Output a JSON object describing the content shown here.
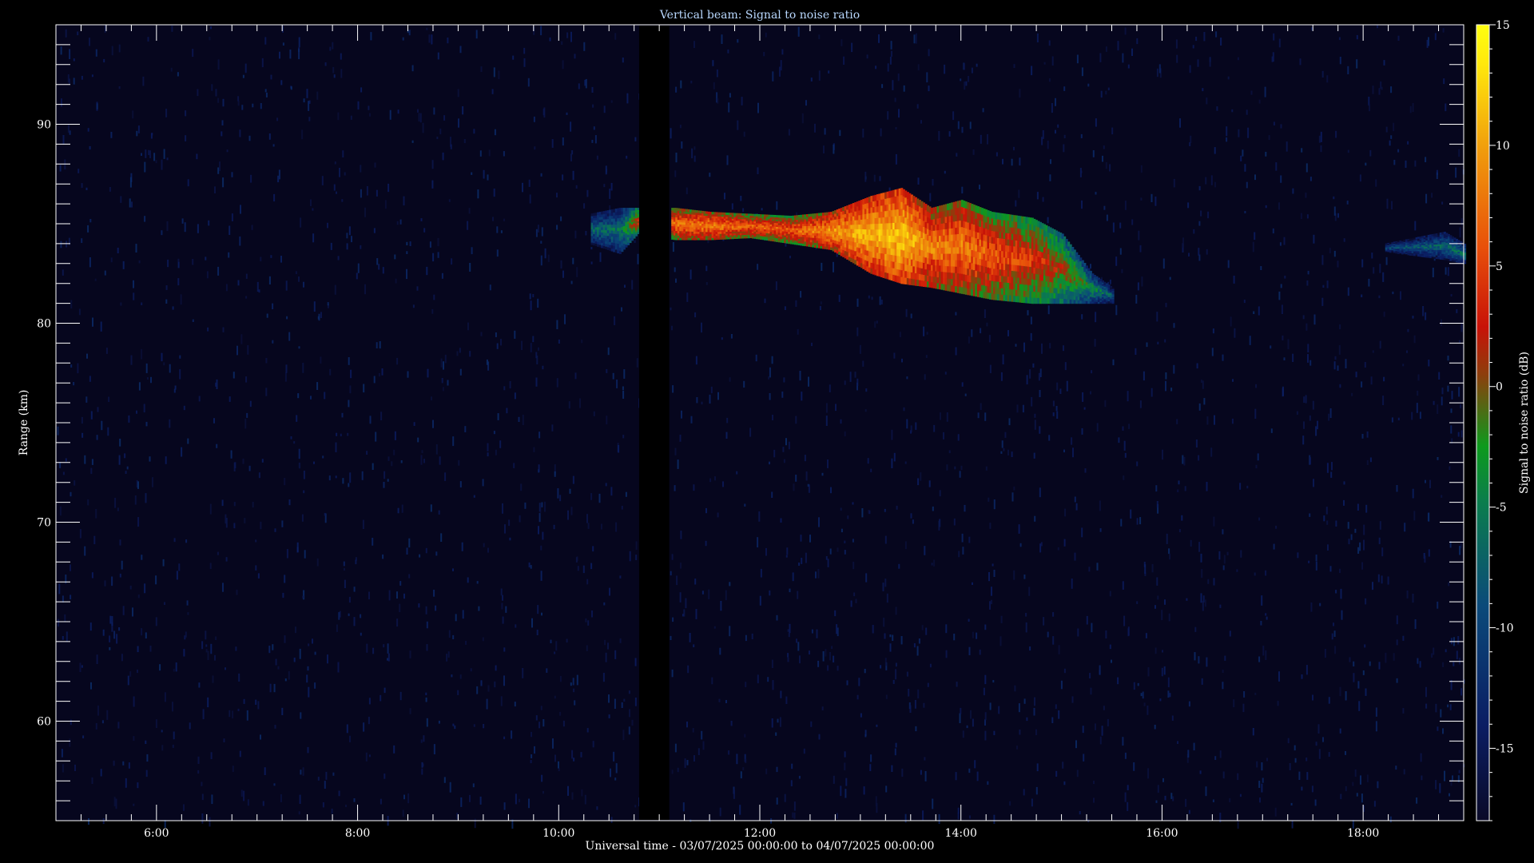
{
  "chart_data": {
    "type": "heatmap",
    "title": "Vertical beam: Signal to noise ratio",
    "xlabel": "Universal time - 03/07/2025 00:00:00 to 04/07/2025 00:00:00",
    "ylabel": "Range (km)",
    "colorbar_label": "Signal to noise ratio (dB)",
    "xlim": [
      5.0,
      19.0
    ],
    "ylim": [
      55.0,
      95.0
    ],
    "clim": [
      -18,
      15
    ],
    "x_ticks": [
      {
        "value": 6,
        "label": "6:00"
      },
      {
        "value": 8,
        "label": "8:00"
      },
      {
        "value": 10,
        "label": "10:00"
      },
      {
        "value": 12,
        "label": "12:00"
      },
      {
        "value": 14,
        "label": "14:00"
      },
      {
        "value": 16,
        "label": "16:00"
      },
      {
        "value": 18,
        "label": "18:00"
      }
    ],
    "y_ticks": [
      {
        "value": 60,
        "label": "60"
      },
      {
        "value": 70,
        "label": "70"
      },
      {
        "value": 80,
        "label": "80"
      },
      {
        "value": 90,
        "label": "90"
      }
    ],
    "colorbar_ticks": [
      {
        "value": 15,
        "label": "15"
      },
      {
        "value": 10,
        "label": "10"
      },
      {
        "value": 5,
        "label": "5"
      },
      {
        "value": 0,
        "label": "0"
      },
      {
        "value": -5,
        "label": "-5"
      },
      {
        "value": -10,
        "label": "-10"
      },
      {
        "value": -15,
        "label": "-15"
      }
    ],
    "background_snr_db": -17,
    "data_gap": [
      10.8,
      11.1
    ],
    "echo_layer": [
      {
        "time": 10.3,
        "range_bottom": 84.0,
        "range_top": 85.5,
        "snr": -7
      },
      {
        "time": 10.6,
        "range_bottom": 83.5,
        "range_top": 85.8,
        "snr": -6
      },
      {
        "time": 10.78,
        "range_bottom": 84.5,
        "range_top": 85.8,
        "snr": 3
      },
      {
        "time": 11.15,
        "range_bottom": 84.2,
        "range_top": 85.8,
        "snr": 7
      },
      {
        "time": 11.5,
        "range_bottom": 84.2,
        "range_top": 85.6,
        "snr": 8
      },
      {
        "time": 11.9,
        "range_bottom": 84.3,
        "range_top": 85.5,
        "snr": 6
      },
      {
        "time": 12.3,
        "range_bottom": 84.0,
        "range_top": 85.4,
        "snr": 6
      },
      {
        "time": 12.7,
        "range_bottom": 83.7,
        "range_top": 85.6,
        "snr": 9
      },
      {
        "time": 13.1,
        "range_bottom": 82.5,
        "range_top": 86.4,
        "snr": 11
      },
      {
        "time": 13.4,
        "range_bottom": 82.0,
        "range_top": 86.8,
        "snr": 12
      },
      {
        "time": 13.7,
        "range_bottom": 81.8,
        "range_top": 85.8,
        "snr": 8
      },
      {
        "time": 14.0,
        "range_bottom": 81.5,
        "range_top": 86.2,
        "snr": 8
      },
      {
        "time": 14.3,
        "range_bottom": 81.2,
        "range_top": 85.6,
        "snr": 6
      },
      {
        "time": 14.7,
        "range_bottom": 81.0,
        "range_top": 85.3,
        "snr": 4
      },
      {
        "time": 15.0,
        "range_bottom": 81.0,
        "range_top": 84.5,
        "snr": 1
      },
      {
        "time": 15.3,
        "range_bottom": 81.0,
        "range_top": 82.5,
        "snr": -4
      },
      {
        "time": 15.5,
        "range_bottom": 81.0,
        "range_top": 81.8,
        "snr": -8
      },
      {
        "time": 18.2,
        "range_bottom": 83.6,
        "range_top": 84.0,
        "snr": -9
      },
      {
        "time": 18.8,
        "range_bottom": 83.2,
        "range_top": 84.6,
        "snr": -7
      },
      {
        "time": 19.0,
        "range_bottom": 83.0,
        "range_top": 84.0,
        "snr": -6
      }
    ]
  }
}
